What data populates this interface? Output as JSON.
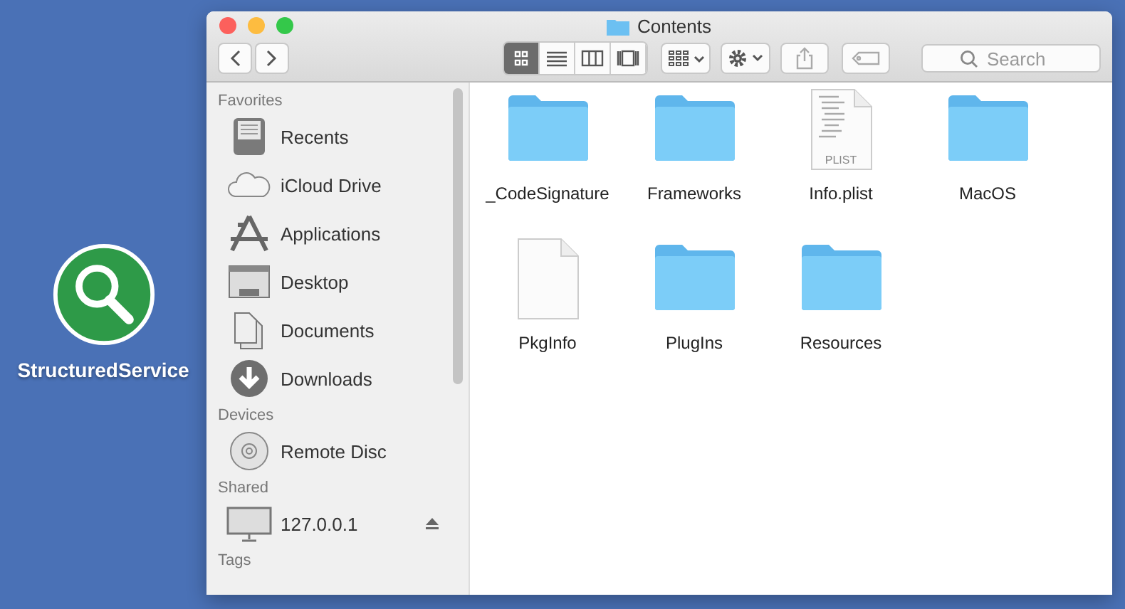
{
  "desktop_icon": {
    "label": "StructuredService"
  },
  "window": {
    "title": "Contents"
  },
  "toolbar": {
    "view_modes": [
      {
        "kind": "icons",
        "selected": true
      },
      {
        "kind": "list",
        "selected": false
      },
      {
        "kind": "columns",
        "selected": false
      },
      {
        "kind": "gallery",
        "selected": false
      }
    ],
    "search": {
      "placeholder": "Search"
    }
  },
  "sidebar": {
    "sections": [
      {
        "heading": "Favorites",
        "items": [
          {
            "label": "Recents",
            "kind": "recents"
          },
          {
            "label": "iCloud Drive",
            "kind": "cloud"
          },
          {
            "label": "Applications",
            "kind": "apps"
          },
          {
            "label": "Desktop",
            "kind": "desktop"
          },
          {
            "label": "Documents",
            "kind": "documents"
          },
          {
            "label": "Downloads",
            "kind": "downloads"
          }
        ]
      },
      {
        "heading": "Devices",
        "items": [
          {
            "label": "Remote Disc",
            "kind": "disc"
          }
        ]
      },
      {
        "heading": "Shared",
        "items": [
          {
            "label": "127.0.0.1",
            "kind": "monitor",
            "ejectable": true
          }
        ]
      },
      {
        "heading": "Tags"
      }
    ]
  },
  "files": [
    {
      "name": "_CodeSignature",
      "kind": "folder"
    },
    {
      "name": "Frameworks",
      "kind": "folder"
    },
    {
      "name": "Info.plist",
      "kind": "plist",
      "badge": "PLIST"
    },
    {
      "name": "MacOS",
      "kind": "folder"
    },
    {
      "name": "PkgInfo",
      "kind": "file"
    },
    {
      "name": "PlugIns",
      "kind": "folder"
    },
    {
      "name": "Resources",
      "kind": "folder"
    }
  ]
}
